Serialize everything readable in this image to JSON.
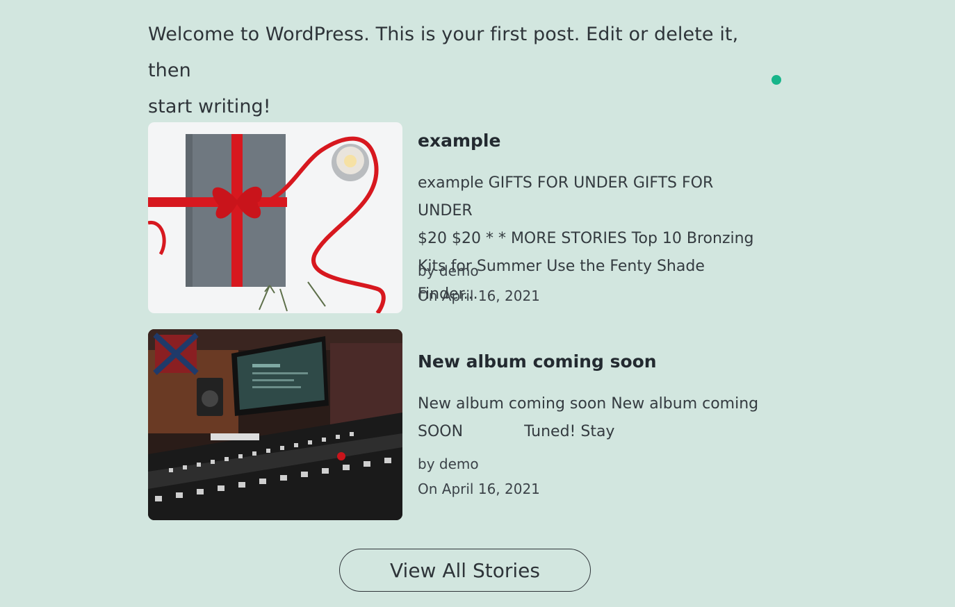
{
  "intro": {
    "line1": "Welcome to WordPress. This is your first post. Edit or delete it, then",
    "line2": "start writing!"
  },
  "colors": {
    "background": "#d2e6df",
    "accent_dot": "#17b58a",
    "text": "#2e3439"
  },
  "posts": [
    {
      "title": "example",
      "excerpt_lines": [
        "example GIFTS FOR UNDER GIFTS FOR UNDER",
        "$20 $20 * * MORE STORIES Top 10 Bronzing",
        "Kits for Summer Use the Fenty Shade Finder..."
      ],
      "author": "by demo",
      "date": "On April 16, 2021",
      "image_icon": "gift-book-with-red-ribbon"
    },
    {
      "title": "New album coming soon",
      "excerpt_lines": [
        "New album coming soon New album  coming",
        "SOON",
        "Tuned! Stay"
      ],
      "author": "by demo",
      "date": "On April 16, 2021",
      "image_icon": "recording-studio-mixing-console"
    }
  ],
  "view_all_button": "View All Stories"
}
